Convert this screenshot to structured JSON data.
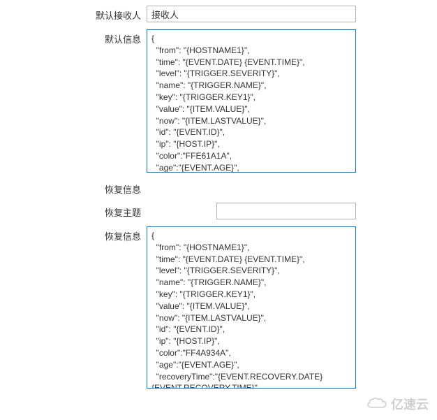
{
  "form": {
    "recipient": {
      "label": "默认接收人",
      "value": "接收人"
    },
    "defaultMessage": {
      "label": "默认信息",
      "value": "{\n  \"from\": \"{HOSTNAME1}\",\n  \"time\": \"{EVENT.DATE} {EVENT.TIME}\",\n  \"level\": \"{TRIGGER.SEVERITY}\",\n  \"name\": \"{TRIGGER.NAME}\",\n  \"key\": \"{TRIGGER.KEY1}\",\n  \"value\": \"{ITEM.VALUE}\",\n  \"now\": \"{ITEM.LASTVALUE}\",\n  \"id\": \"{EVENT.ID}\",\n  \"ip\": \"{HOST.IP}\",\n  \"color\":\"FFE61A1A\",\n  \"age\":\"{EVENT.AGE}\",\n  \"status\":\"{EVENT.STATUS}\"\n}"
    },
    "recoveryEnable": {
      "label": "恢复信息"
    },
    "recoverySubject": {
      "label": "恢复主题",
      "value": ""
    },
    "recoveryMessage": {
      "label": "恢复信息",
      "value": "{\n  \"from\": \"{HOSTNAME1}\",\n  \"time\": \"{EVENT.DATE} {EVENT.TIME}\",\n  \"level\": \"{TRIGGER.SEVERITY}\",\n  \"name\": \"{TRIGGER.NAME}\",\n  \"key\": \"{TRIGGER.KEY1}\",\n  \"value\": \"{ITEM.VALUE}\",\n  \"now\": \"{ITEM.LASTVALUE}\",\n  \"id\": \"{EVENT.ID}\",\n  \"ip\": \"{HOST.IP}\",\n  \"color\":\"FF4A934A\",\n  \"age\":\"{EVENT.AGE}\",\n  \"recoveryTime\":\"{EVENT.RECOVERY.DATE} {EVENT.RECOVERY.TIME}\",\n  \"status\":\"{EVENT.RECOVERY.STATUS}\"\n}"
    }
  },
  "watermark": {
    "text": "亿速云"
  }
}
